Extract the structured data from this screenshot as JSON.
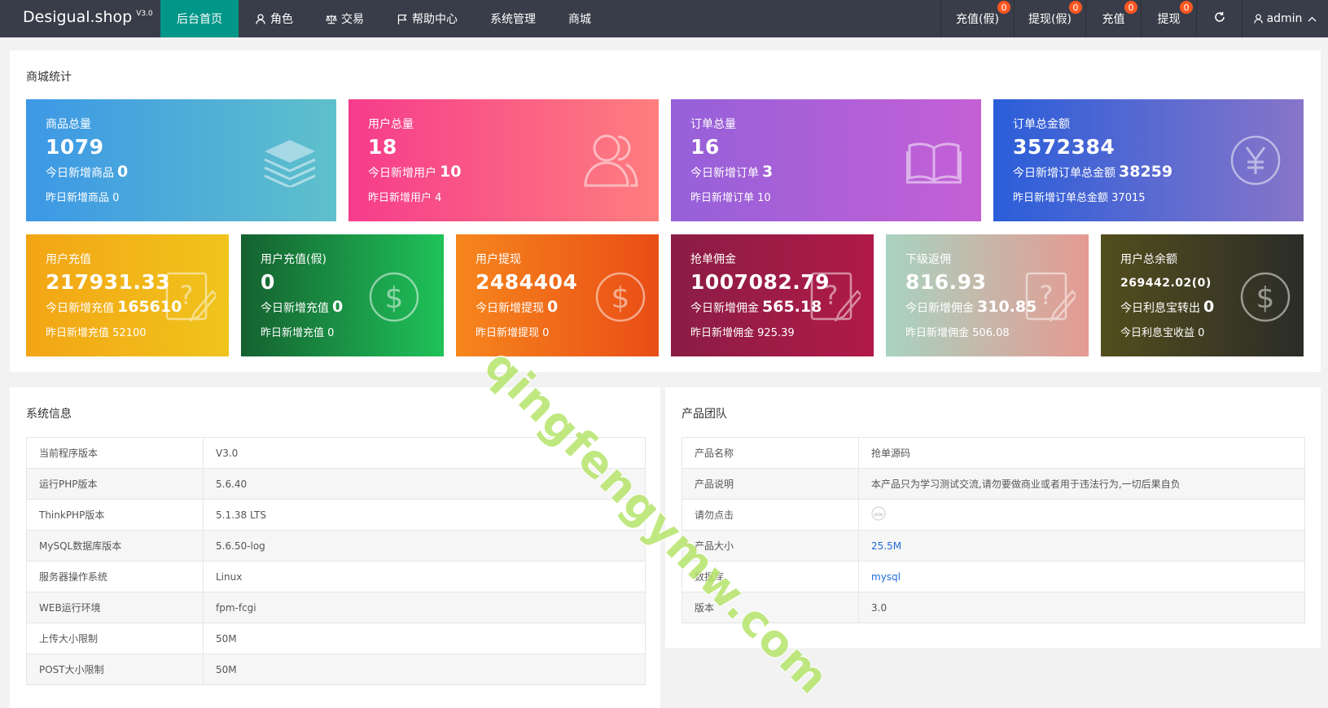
{
  "header": {
    "logo": "Desigual.shop",
    "version": "V3.0",
    "nav": [
      {
        "label": "后台首页",
        "icon": null,
        "active": true
      },
      {
        "label": "角色",
        "icon": "user-icon"
      },
      {
        "label": "交易",
        "icon": "scale-icon"
      },
      {
        "label": "帮助中心",
        "icon": "flag-icon"
      },
      {
        "label": "系统管理",
        "icon": null
      },
      {
        "label": "商城",
        "icon": null
      }
    ],
    "right": [
      {
        "label": "充值(假)",
        "badge": "0"
      },
      {
        "label": "提现(假)",
        "badge": "0"
      },
      {
        "label": "充值",
        "badge": "0"
      },
      {
        "label": "提现",
        "badge": "0"
      }
    ],
    "user": "admin"
  },
  "stats": {
    "title": "商城统计",
    "goods": {
      "label": "商品总量",
      "value": "1079",
      "today_label": "今日新增商品",
      "today": "0",
      "yesterday_label": "昨日新增商品",
      "yesterday": "0"
    },
    "users": {
      "label": "用户总量",
      "value": "18",
      "today_label": "今日新增用户",
      "today": "10",
      "yesterday_label": "昨日新增用户",
      "yesterday": "4"
    },
    "orders": {
      "label": "订单总量",
      "value": "16",
      "today_label": "今日新增订单",
      "today": "3",
      "yesterday_label": "昨日新增订单",
      "yesterday": "10"
    },
    "order_amount": {
      "label": "订单总金额",
      "value": "3572384",
      "today_label": "今日新增订单总金额",
      "today": "38259",
      "yesterday_label": "昨日新增订单总金额",
      "yesterday": "37015"
    },
    "recharge": {
      "label": "用户充值",
      "value": "217931.33",
      "today_label": "今日新增充值",
      "today": "165610",
      "yesterday_label": "昨日新增充值",
      "yesterday": "52100"
    },
    "recharge_fake": {
      "label": "用户充值(假)",
      "value": "0",
      "today_label": "今日新增充值",
      "today": "0",
      "yesterday_label": "昨日新增充值",
      "yesterday": "0"
    },
    "withdraw": {
      "label": "用户提现",
      "value": "2484404",
      "today_label": "今日新增提现",
      "today": "0",
      "yesterday_label": "昨日新增提现",
      "yesterday": "0"
    },
    "commission": {
      "label": "抢单佣金",
      "value": "1007082.79",
      "today_label": "今日新增佣金",
      "today": "565.18",
      "yesterday_label": "昨日新增佣金",
      "yesterday": "925.39"
    },
    "rebate": {
      "label": "下级返佣",
      "value": "816.93",
      "today_label": "今日新增佣金",
      "today": "310.85",
      "yesterday_label": "昨日新增佣金",
      "yesterday": "506.08"
    },
    "balance": {
      "label": "用户总余额",
      "value": "269442.02(0)",
      "today_label": "今日利息宝转出",
      "today": "0",
      "yesterday_label": "今日利息宝收益",
      "yesterday": "0"
    }
  },
  "sysinfo": {
    "title": "系统信息",
    "rows": [
      {
        "k": "当前程序版本",
        "v": "V3.0"
      },
      {
        "k": "运行PHP版本",
        "v": "5.6.40"
      },
      {
        "k": "ThinkPHP版本",
        "v": "5.1.38 LTS"
      },
      {
        "k": "MySQL数据库版本",
        "v": "5.6.50-log"
      },
      {
        "k": "服务器操作系统",
        "v": "Linux"
      },
      {
        "k": "WEB运行环境",
        "v": "fpm-fcgi"
      },
      {
        "k": "上传大小限制",
        "v": "50M"
      },
      {
        "k": "POST大小限制",
        "v": "50M"
      }
    ]
  },
  "product": {
    "title": "产品团队",
    "rows": [
      {
        "k": "产品名称",
        "v": "抢单源码"
      },
      {
        "k": "产品说明",
        "v": "本产品只为学习测试交流,请勿要做商业或者用于违法行为,一切后果自负"
      },
      {
        "k": "请勿点击",
        "v": ""
      },
      {
        "k": "产品大小",
        "v": "25.5M"
      },
      {
        "k": "数据库",
        "v": "mysql"
      },
      {
        "k": "版本",
        "v": "3.0"
      }
    ]
  },
  "watermark": "qingfengymw.com"
}
